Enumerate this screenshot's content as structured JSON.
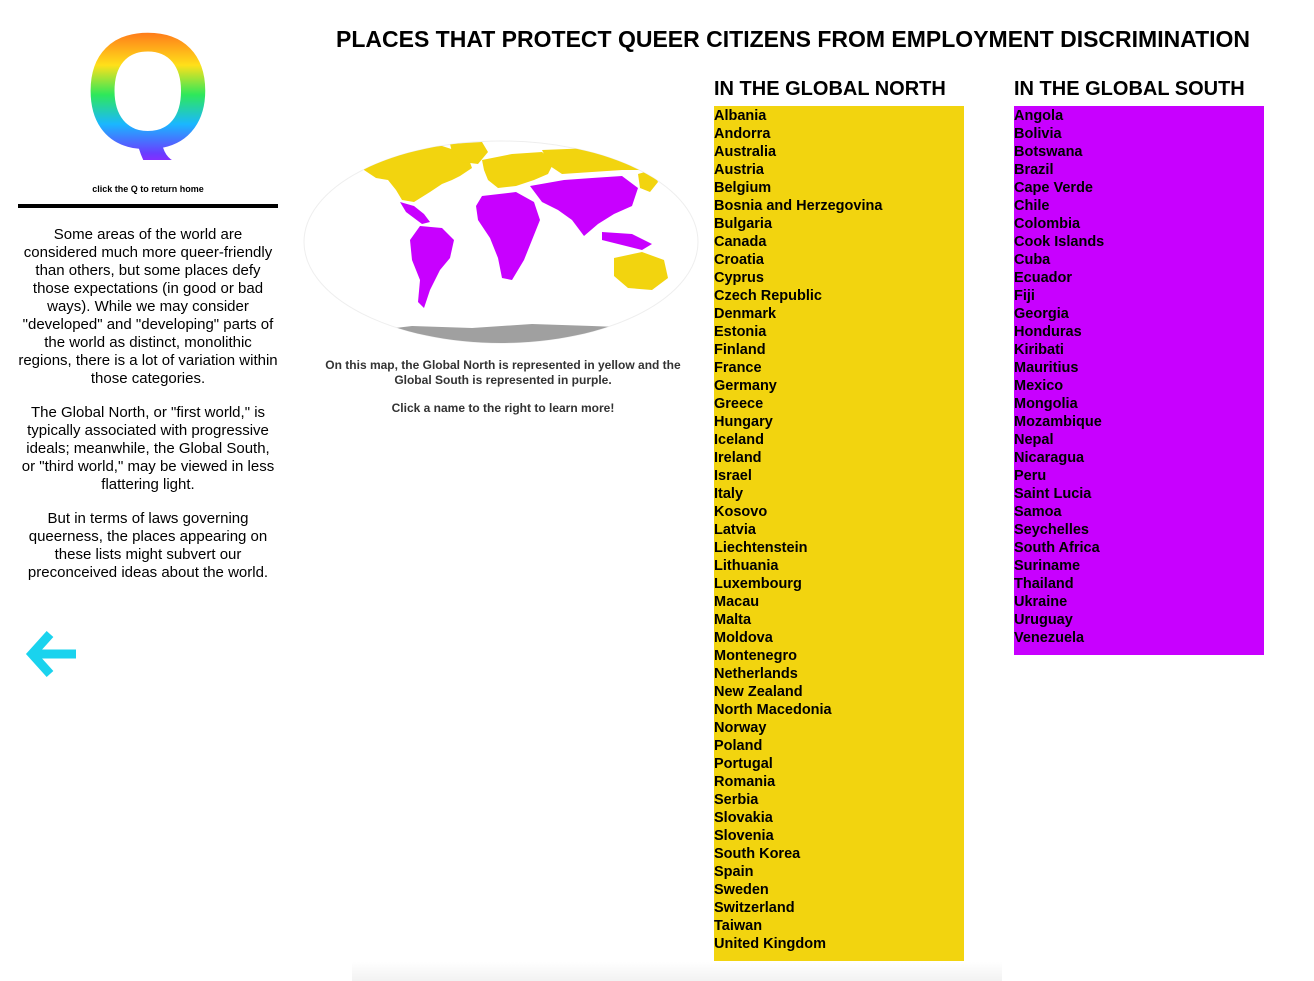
{
  "header": {
    "title": "PLACES THAT PROTECT QUEER CITIZENS FROM EMPLOYMENT DISCRIMINATION"
  },
  "sidebar": {
    "logo_letter": "Q",
    "home_hint": "click the Q to return home",
    "paragraphs": [
      "Some areas of the world are considered much more queer-friendly than others, but some places defy those expectations (in good or bad ways). While we may consider \"developed\" and \"developing\" parts of the world as distinct, monolithic regions, there is a lot of variation within those categories.",
      "The Global North, or \"first world,\" is typically associated with progressive ideals; meanwhile, the Global South, or \"third world,\" may be viewed in less flattering light.",
      "But in terms of laws governing queerness, the places appearing on these lists might subvert our preconceived ideas about the world."
    ],
    "back_icon": "arrow-left-icon"
  },
  "map": {
    "caption_lines": [
      "On this map, the Global North is represented in yellow and the Global South is represented in purple."
    ],
    "instruction": "Click a name to the right to learn more!"
  },
  "colors": {
    "north": "#f2d40f",
    "south": "#c800ff",
    "antarctica": "#a0a0a0",
    "arrow": "#1ad3ee"
  },
  "north": {
    "heading": "IN THE GLOBAL NORTH",
    "countries": [
      "Albania",
      "Andorra",
      "Australia",
      "Austria",
      "Belgium",
      "Bosnia and Herzegovina",
      "Bulgaria",
      "Canada",
      "Croatia",
      "Cyprus",
      "Czech Republic",
      "Denmark",
      "Estonia",
      "Finland",
      "France",
      "Germany",
      "Greece",
      "Hungary",
      "Iceland",
      "Ireland",
      "Israel",
      "Italy",
      "Kosovo",
      "Latvia",
      "Liechtenstein",
      "Lithuania",
      "Luxembourg",
      "Macau",
      "Malta",
      "Moldova",
      "Montenegro",
      "Netherlands",
      "New Zealand",
      "North Macedonia",
      "Norway",
      "Poland",
      "Portugal",
      "Romania",
      "Serbia",
      "Slovakia",
      "Slovenia",
      "South Korea",
      "Spain",
      "Sweden",
      "Switzerland",
      "Taiwan",
      "United Kingdom"
    ]
  },
  "south": {
    "heading": "IN THE GLOBAL SOUTH",
    "countries": [
      "Angola",
      "Bolivia",
      "Botswana",
      "Brazil",
      "Cape Verde",
      "Chile",
      "Colombia",
      "Cook Islands",
      "Cuba",
      "Ecuador",
      "Fiji",
      "Georgia",
      "Honduras",
      "Kiribati",
      "Mauritius",
      "Mexico",
      "Mongolia",
      "Mozambique",
      "Nepal",
      "Nicaragua",
      "Peru",
      "Saint Lucia",
      "Samoa",
      "Seychelles",
      "South Africa",
      "Suriname",
      "Thailand",
      "Ukraine",
      "Uruguay",
      "Venezuela"
    ]
  }
}
